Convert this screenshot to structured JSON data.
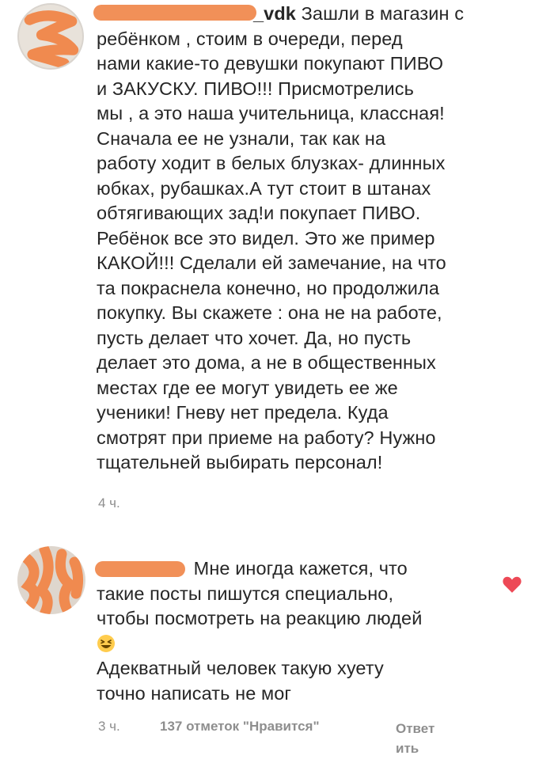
{
  "comment1": {
    "username_suffix": "_vdk",
    "text": "Зашли в магазин с\nребёнком , стоим в очереди, перед\nнами какие-то девушки покупают ПИВО\nи ЗАКУСКУ. ПИВО!!! Присмотрелись\nмы , а это наша учительница, классная!\nСначала ее не узнали, так как на\nработу ходит в белых блузках- длинных\nюбках, рубашках.А тут стоит в штанах\nобтягивающих зад!и покупает ПИВО.\nРебёнок все это видел. Это же пример\nКАКОЙ!!! Сделали ей замечание, на что\nта покраснела конечно, но продолжила\nпокупку. Вы скажете : она не на работе,\nпусть делает что хочет. Да, но пусть\nделает это дома, а не в общественных\nместах где ее могут увидеть ее же\nученики! Гневу нет предела. Куда\nсмотрят при приеме на работу? Нужно\nтщательней выбирать персонал!",
    "time": "4 ч."
  },
  "comment2": {
    "text_line1": "Мне иногда кажется, что\nтакие посты пишутся специально,\nчтобы посмотреть на реакцию людей",
    "emoji": "laughing-face-emoji",
    "text_line2": "Адекватный человек такую хуету\nточно написать не мог",
    "time": "3 ч.",
    "likes": "137 отметок \"Нравится\"",
    "reply": "Ответ\nить",
    "liked_color": "#ed4956"
  },
  "colors": {
    "redaction": "#f08a4f",
    "meta_text": "#8e8e8e"
  }
}
